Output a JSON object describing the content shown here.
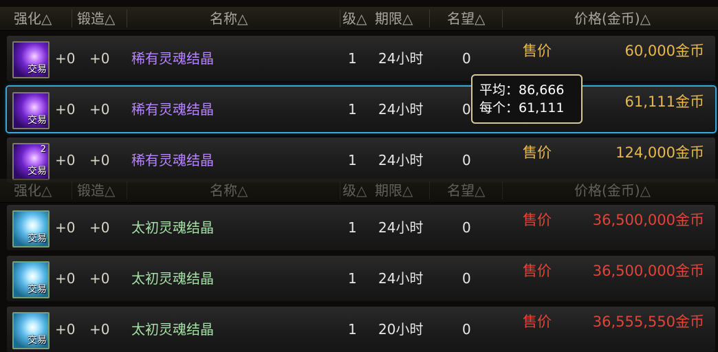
{
  "headers": {
    "enhance": "强化△",
    "forge": "锻造△",
    "name": "名称△",
    "level": "级△",
    "period": "期限△",
    "fame": "名望△",
    "price": "价格(金币)△"
  },
  "rows": [
    {
      "enhance": "+0",
      "forge": "+0",
      "name": "稀有灵魂结晶",
      "level": "1",
      "period": "24小时",
      "fame": "0",
      "sale_label": "售价",
      "price": "60,000金币",
      "trade": "交易",
      "stack": ""
    },
    {
      "enhance": "+0",
      "forge": "+0",
      "name": "稀有灵魂结晶",
      "level": "1",
      "period": "24小时",
      "fame": "0",
      "sale_label": "",
      "price": "61,111金币",
      "trade": "交易",
      "stack": ""
    },
    {
      "enhance": "+0",
      "forge": "+0",
      "name": "稀有灵魂结晶",
      "level": "1",
      "period": "24小时",
      "fame": "0",
      "sale_label": "售价",
      "price": "124,000金币",
      "trade": "交易",
      "stack": "2"
    },
    {
      "enhance": "+0",
      "forge": "+0",
      "name": "太初灵魂结晶",
      "level": "1",
      "period": "24小时",
      "fame": "0",
      "sale_label": "售价",
      "price": "36,500,000金币",
      "trade": "交易",
      "stack": ""
    },
    {
      "enhance": "+0",
      "forge": "+0",
      "name": "太初灵魂结晶",
      "level": "1",
      "period": "24小时",
      "fame": "0",
      "sale_label": "售价",
      "price": "36,500,000金币",
      "trade": "交易",
      "stack": ""
    },
    {
      "enhance": "+0",
      "forge": "+0",
      "name": "太初灵魂结晶",
      "level": "1",
      "period": "20小时",
      "fame": "0",
      "sale_label": "售价",
      "price": "36,555,550金币",
      "trade": "交易",
      "stack": ""
    }
  ],
  "tooltip": {
    "avg_label": "平均：86,666",
    "each_label": "每个：61,111"
  },
  "colors": {
    "gold_price": "#e8b84f",
    "red_price": "#e24438",
    "rare_name": "#b784ff",
    "primal_name": "#a6e0a6",
    "selection": "#3aa7d6"
  }
}
